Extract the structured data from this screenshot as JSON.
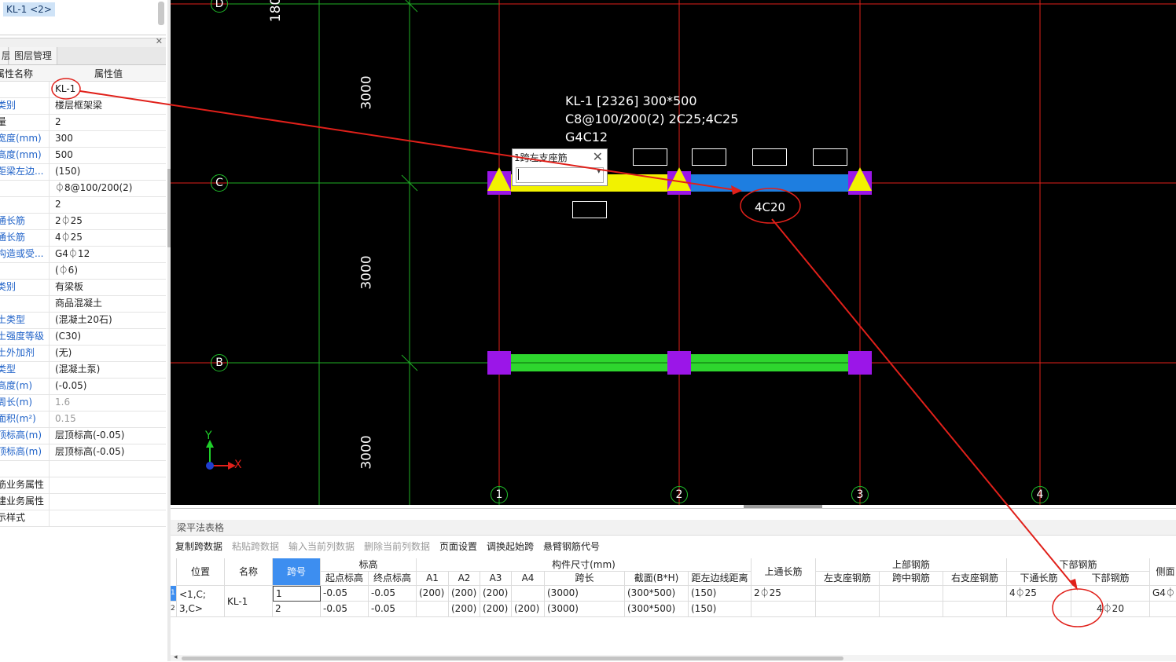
{
  "element_list": {
    "selected": "KL-1 <2>"
  },
  "left_tabs": [
    "层",
    "图层管理"
  ],
  "properties": {
    "header_name": "属性名称",
    "header_value": "属性值",
    "rows": [
      {
        "name": "",
        "value": "KL-1"
      },
      {
        "name": "类别",
        "value": "楼层框架梁"
      },
      {
        "name": "量",
        "value": "2"
      },
      {
        "name": "宽度(mm)",
        "value": "300"
      },
      {
        "name": "高度(mm)",
        "value": "500"
      },
      {
        "name": "距梁左边...",
        "value": "(150)"
      },
      {
        "name": "",
        "value": "⏀8@100/200(2)"
      },
      {
        "name": "",
        "value": "2"
      },
      {
        "name": "通长筋",
        "value": "2⏀25"
      },
      {
        "name": "通长筋",
        "value": "4⏀25"
      },
      {
        "name": "构造或受...",
        "value": "G4⏀12"
      },
      {
        "name": "",
        "value": "(⏀6)"
      },
      {
        "name": "类别",
        "value": "有梁板"
      },
      {
        "name": "",
        "value": "商品混凝土"
      },
      {
        "name": "土类型",
        "value": "(混凝土20石)"
      },
      {
        "name": "土强度等级",
        "value": "(C30)"
      },
      {
        "name": "土外加剂",
        "value": "(无)"
      },
      {
        "name": "类型",
        "value": "(混凝土泵)"
      },
      {
        "name": "高度(m)",
        "value": "(-0.05)"
      },
      {
        "name": "周长(m)",
        "value": "1.6"
      },
      {
        "name": "面积(m²)",
        "value": "0.15"
      },
      {
        "name": "顶标高(m)",
        "value": "层顶标高(-0.05)"
      },
      {
        "name": "顶标高(m)",
        "value": "层顶标高(-0.05)"
      },
      {
        "name": "",
        "value": ""
      },
      {
        "name": "筋业务属性",
        "value": ""
      },
      {
        "name": "建业务属性",
        "value": ""
      },
      {
        "name": "示样式",
        "value": ""
      }
    ]
  },
  "canvas": {
    "axis_rows": [
      "D",
      "C",
      "B"
    ],
    "axis_cols": [
      "1",
      "2",
      "3",
      "4"
    ],
    "dims": [
      "180",
      "3000",
      "3000",
      "3000"
    ],
    "annotation_lines": [
      "KL-1 [2326] 300*500",
      "C8@100/200(2) 2C25;4C25",
      "G4C12"
    ],
    "popup_title": "1跨左支座筋",
    "label_4c20": "4C20",
    "coord_y": "Y",
    "coord_x": "X",
    "colors": {
      "background": "#000000",
      "grid_red": "#e0201a",
      "grid_green": "#1fae25",
      "beam_yellow": "#f2f200",
      "beam_blue": "#1e7ee0",
      "beam_green": "#2ed62e",
      "column_purple": "#9b16e8"
    }
  },
  "bottom": {
    "title": "梁平法表格",
    "toolbar": [
      {
        "label": "复制跨数据",
        "enabled": true
      },
      {
        "label": "粘贴跨数据",
        "enabled": false
      },
      {
        "label": "输入当前列数据",
        "enabled": false
      },
      {
        "label": "删除当前列数据",
        "enabled": false
      },
      {
        "label": "页面设置",
        "enabled": true
      },
      {
        "label": "调换起始跨",
        "enabled": true
      },
      {
        "label": "悬臂钢筋代号",
        "enabled": true
      }
    ],
    "group_headers": {
      "elevation": "标高",
      "size": "构件尺寸(mm)",
      "top_bars": "上部钢筋",
      "bottom_bars": "下部钢筋"
    },
    "col_headers": {
      "position": "位置",
      "name": "名称",
      "span": "跨号",
      "start_elev": "起点标高",
      "end_elev": "终点标高",
      "a1": "A1",
      "a2": "A2",
      "a3": "A3",
      "a4": "A4",
      "span_len": "跨长",
      "section": "截面(B*H)",
      "offset": "距左边线距离",
      "top_through": "上通长筋",
      "left_support": "左支座钢筋",
      "mid_span": "跨中钢筋",
      "right_support": "右支座钢筋",
      "bottom_through": "下通长筋",
      "bottom_bar": "下部钢筋",
      "side": "侧面"
    },
    "position_value": "<1,C;\n3,C>",
    "position_line1": "<1,C;",
    "position_line2": "3,C>",
    "name_value": "KL-1",
    "rows": [
      {
        "num": "1",
        "span": "1",
        "start": "-0.05",
        "end": "-0.05",
        "a1": "(200)",
        "a2": "(200)",
        "a3": "(200)",
        "a4": "",
        "len": "(3000)",
        "section": "(300*500)",
        "offset": "(150)",
        "top_through": "2⏀25",
        "left_support": "",
        "mid": "",
        "right_support": "",
        "bottom_through": "4⏀25",
        "bottom_bar": "",
        "side": "G4⏀"
      },
      {
        "num": "2",
        "span": "2",
        "start": "-0.05",
        "end": "-0.05",
        "a1": "",
        "a2": "(200)",
        "a3": "(200)",
        "a4": "(200)",
        "len": "(3000)",
        "section": "(300*500)",
        "offset": "(150)",
        "top_through": "",
        "left_support": "",
        "mid": "",
        "right_support": "",
        "bottom_through": "",
        "bottom_bar": "4⏀20",
        "side": ""
      }
    ]
  }
}
